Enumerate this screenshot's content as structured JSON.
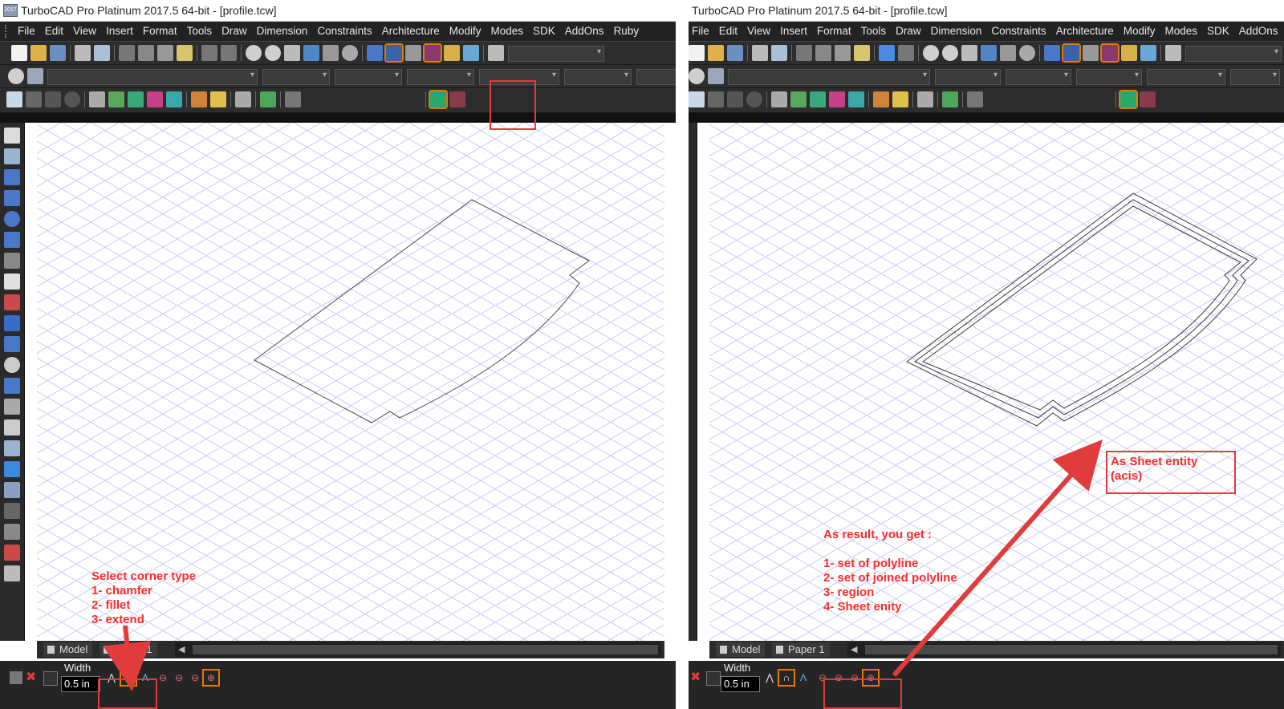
{
  "left_window": {
    "title": "TurboCAD Pro Platinum 2017.5 64-bit - [profile.tcw]",
    "menu": [
      "File",
      "Edit",
      "View",
      "Insert",
      "Format",
      "Tools",
      "Draw",
      "Dimension",
      "Constraints",
      "Architecture",
      "Modify",
      "Modes",
      "SDK",
      "AddOns",
      "Ruby"
    ],
    "tabs": [
      "Model",
      "Paper 1"
    ],
    "width_label": "Width",
    "width_value": "0.5 in",
    "annotation": "Select corner type\n1- chamfer\n2- fillet\n3- extend"
  },
  "right_window": {
    "title": "TurboCAD Pro Platinum 2017.5 64-bit - [profile.tcw]",
    "menu": [
      "File",
      "Edit",
      "View",
      "Insert",
      "Format",
      "Tools",
      "Draw",
      "Dimension",
      "Constraints",
      "Architecture",
      "Modify",
      "Modes",
      "SDK",
      "AddOns"
    ],
    "tabs": [
      "Model",
      "Paper 1"
    ],
    "width_label": "Width",
    "width_value": "0.5 in",
    "annotation_result": "As result, you get :\n\n1- set of polyline\n2- set of joined polyline\n3- region\n4- Sheet enity",
    "annotation_sheet": "As Sheet entity\n(acis)"
  },
  "icons": {
    "app": "turbocad-app-icon",
    "corner_chamfer": "chamfer-corner-icon",
    "corner_fillet": "fillet-corner-icon",
    "corner_extend": "extend-corner-icon"
  },
  "colors": {
    "annotation_red": "#ff2a2a",
    "highlight_orange": "#e07b00",
    "menubar": "#222222",
    "grid": "#c9cdf2"
  }
}
